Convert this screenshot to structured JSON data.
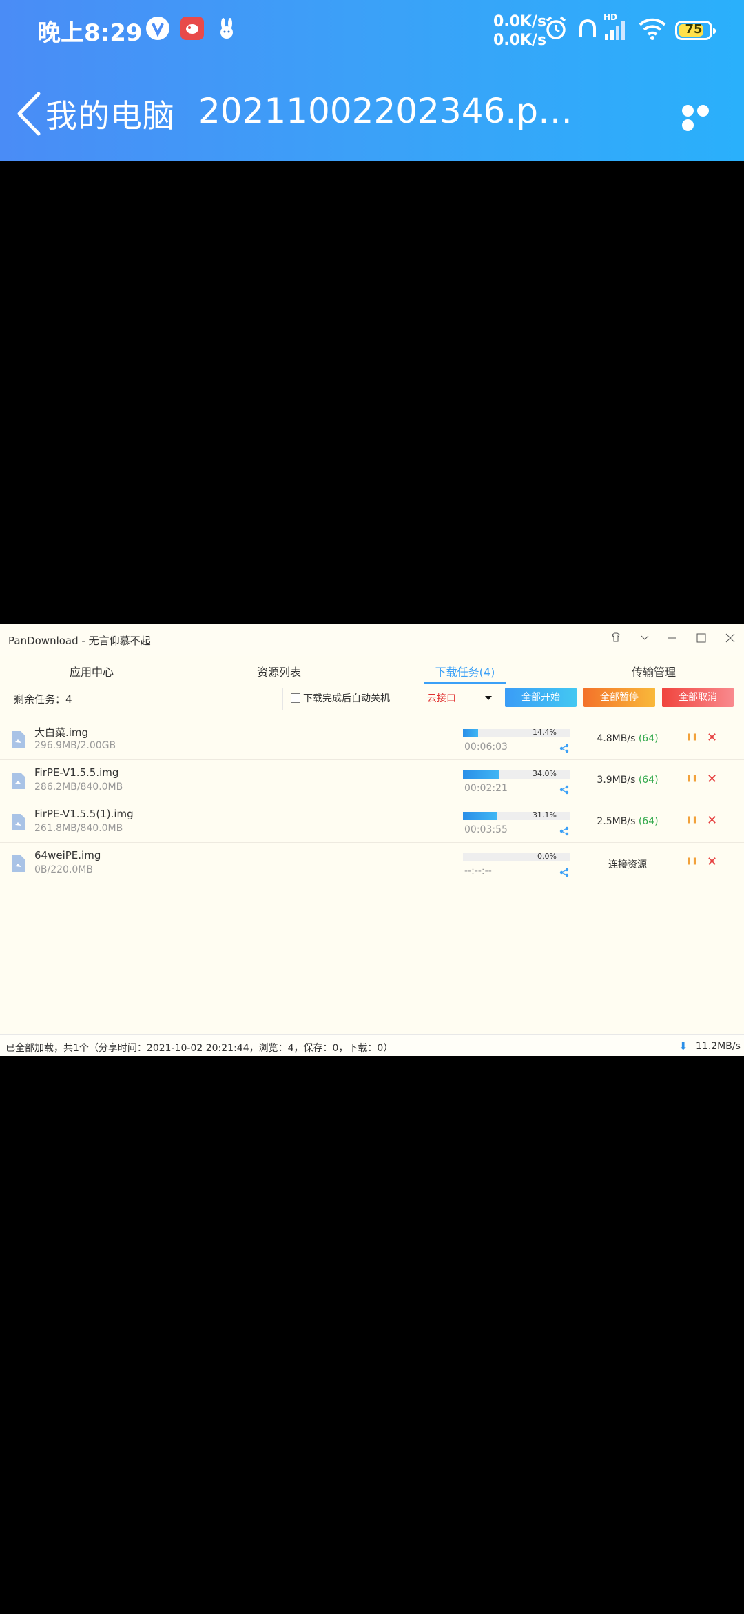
{
  "status_bar": {
    "time": "晚上8:29",
    "net_speed_up": "0.0K/s",
    "net_speed_down": "0.0K/s",
    "battery_level": "75",
    "network_badge": "HD",
    "icons": [
      "v-app-icon",
      "bird-app-icon",
      "rabbit-app-icon",
      "alarm-icon",
      "headset-icon",
      "signal-icon",
      "wifi-icon",
      "battery-icon"
    ]
  },
  "header": {
    "back_label": "我的电脑",
    "file_title": "20211002202346.p…"
  },
  "window": {
    "title": "PanDownload - 无言仰慕不起",
    "tabs": [
      "应用中心",
      "资源列表",
      "下载任务(4)",
      "传输管理"
    ],
    "active_tab": 2,
    "toolbar": {
      "remaining": "剩余任务：4",
      "auto_shutdown_label": "下载完成后自动关机",
      "interface_select": "云接口",
      "start_all": "全部开始",
      "pause_all": "全部暂停",
      "cancel_all": "全部取消"
    },
    "tasks": [
      {
        "name": "大白菜.img",
        "size": "296.9MB/2.00GB",
        "progress": 14.4,
        "percent": "14.4%",
        "time": "00:06:03",
        "speed": "4.8MB/s",
        "threads": "(64)"
      },
      {
        "name": "FirPE-V1.5.5.img",
        "size": "286.2MB/840.0MB",
        "progress": 34.0,
        "percent": "34.0%",
        "time": "00:02:21",
        "speed": "3.9MB/s",
        "threads": "(64)"
      },
      {
        "name": "FirPE-V1.5.5(1).img",
        "size": "261.8MB/840.0MB",
        "progress": 31.1,
        "percent": "31.1%",
        "time": "00:03:55",
        "speed": "2.5MB/s",
        "threads": "(64)"
      },
      {
        "name": "64weiPE.img",
        "size": "0B/220.0MB",
        "progress": 0.0,
        "percent": "0.0%",
        "time": "--:--:--",
        "speed": "连接资源",
        "threads": ""
      }
    ],
    "status_text": "已全部加载，共1个（分享时间：2021-10-02 20:21:44，浏览：4，保存：0，下载：0）",
    "total_speed": "11.2MB/s"
  },
  "colors": {
    "header_gradient_start": "#4a8cf6",
    "header_gradient_end": "#2ab0fb",
    "accent": "#3ba0f7",
    "danger": "#e64141",
    "pause": "#f2a13a"
  }
}
